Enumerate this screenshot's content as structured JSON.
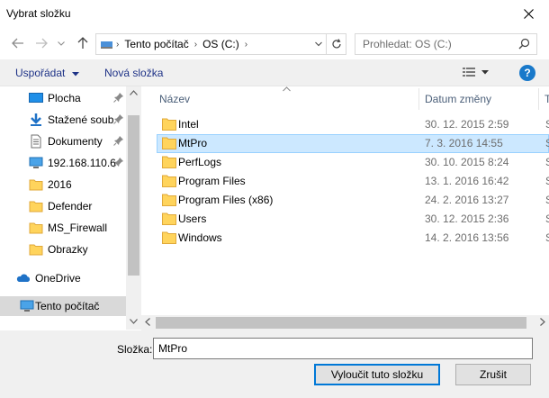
{
  "window": {
    "title": "Vybrat složku"
  },
  "address": {
    "parts": [
      "Tento počítač",
      "OS (C:)"
    ]
  },
  "search": {
    "placeholder": "Prohledat: OS (C:)"
  },
  "toolbar": {
    "organize_label": "Uspořádat",
    "new_folder_label": "Nová složka",
    "help_label": "?"
  },
  "sidebar": {
    "items": [
      {
        "label": "Plocha",
        "icon": "desktop-icon",
        "pinned": true
      },
      {
        "label": "Stažené soub",
        "icon": "download-icon",
        "pinned": true
      },
      {
        "label": "Dokumenty",
        "icon": "document-icon",
        "pinned": true
      },
      {
        "label": "192.168.110.6",
        "icon": "network-drive-icon",
        "pinned": true
      },
      {
        "label": "2016",
        "icon": "folder-icon",
        "pinned": false
      },
      {
        "label": "Defender",
        "icon": "folder-icon",
        "pinned": false
      },
      {
        "label": "MS_Firewall",
        "icon": "folder-icon",
        "pinned": false
      },
      {
        "label": "Obrazky",
        "icon": "folder-icon",
        "pinned": false
      },
      {
        "label": "OneDrive",
        "icon": "onedrive-icon",
        "pinned": false
      },
      {
        "label": "Tento počítač",
        "icon": "computer-icon",
        "pinned": false,
        "selected": true
      }
    ]
  },
  "list": {
    "columns": {
      "name": "Název",
      "date": "Datum změny",
      "type": "T"
    },
    "rows": [
      {
        "name": "Intel",
        "date": "30. 12. 2015 2:59",
        "type": "S"
      },
      {
        "name": "MtPro",
        "date": "7. 3. 2016 14:55",
        "type": "S",
        "selected": true
      },
      {
        "name": "PerfLogs",
        "date": "30. 10. 2015 8:24",
        "type": "S"
      },
      {
        "name": "Program Files",
        "date": "13. 1. 2016 16:42",
        "type": "S"
      },
      {
        "name": "Program Files (x86)",
        "date": "24. 2. 2016 13:27",
        "type": "S"
      },
      {
        "name": "Users",
        "date": "30. 12. 2015 2:36",
        "type": "S"
      },
      {
        "name": "Windows",
        "date": "14. 2. 2016 13:56",
        "type": "S"
      }
    ]
  },
  "footer": {
    "folder_label": "Složka:",
    "folder_value": "MtPro",
    "select_label": "Vyloučit tuto složku",
    "cancel_label": "Zrušit"
  },
  "colors": {
    "accent": "#0078d7",
    "folder": "#ffd45c",
    "selection": "#cce8ff",
    "link": "#1e3287"
  }
}
